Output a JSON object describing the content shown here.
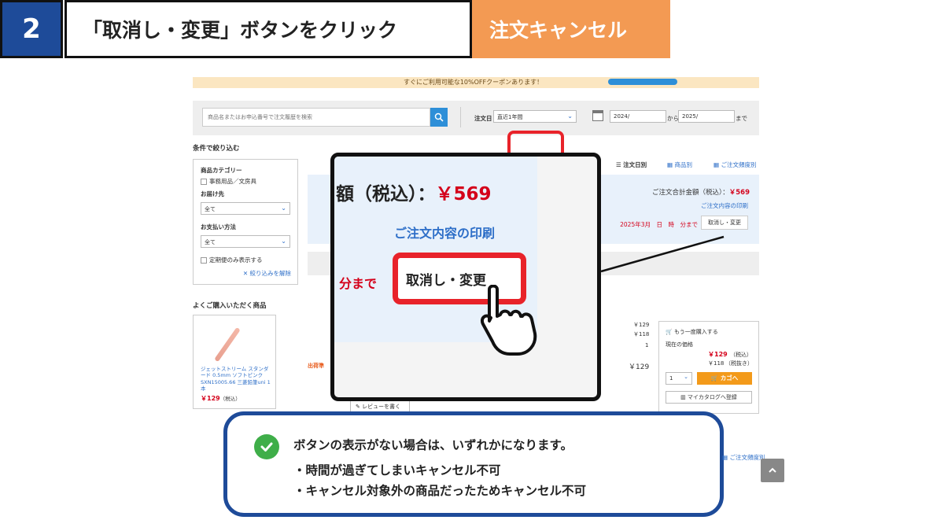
{
  "header": {
    "step_number": "2",
    "title": "「取消し・変更」ボタンをクリック",
    "tag": "注文キャンセル"
  },
  "colors": {
    "step_blue": "#1e4b99",
    "tag_orange": "#f39a53",
    "highlight_red": "#e8232a",
    "price_red": "#d4001a",
    "check_green": "#3fae49"
  },
  "promo": {
    "text": "すぐにご利用可能な10%OFFクーポンあります！"
  },
  "search": {
    "placeholder": "商品名またはお申込番号で注文履歴を検索",
    "order_date_label": "注文日",
    "period_value": "直近1年間",
    "date_from": "2024/",
    "from_word": "から",
    "date_to": "2025/",
    "until_word": "まで"
  },
  "sidebar": {
    "title": "条件で絞り込む",
    "category_heading": "商品カテゴリー",
    "category_option": "事務用品／文房具",
    "delivery_heading": "お届け先",
    "delivery_value": "全て",
    "payment_heading": "お支払い方法",
    "payment_value": "全て",
    "subscription_option": "定期便のみ表示する",
    "clear_link": "✕ 絞り込みを解除"
  },
  "favorites": {
    "title": "よくご購入いただく商品",
    "product_name": "ジェットストリーム スタンダード 0.5mm ソフトピンク SXN15005.66 三菱鉛筆uni 1本",
    "price": "￥129",
    "tax_note": "（税込）"
  },
  "view_links": {
    "by_date": "注文日別",
    "by_product": "商品別",
    "by_frequency": "ご注文頻度別"
  },
  "order": {
    "total_label": "ご注文合計金額（税込）：",
    "total_value": "￥569",
    "print_link": "ご注文内容の印刷",
    "deadline": "2025年3月　日　時　分まで",
    "cancel_button": "取消し・変更",
    "shipping_status": "出荷準"
  },
  "cart": {
    "reorder_label": "もう一度購入する",
    "current_price_label": "現在の価格",
    "price_incl": "￥129",
    "price_incl_note": "（税込）",
    "price_excl": "￥118",
    "price_excl_note": "（税抜き）",
    "qty": "1",
    "add_to_cart": "カゴへ",
    "add_to_catalog": "マイカタログへ登録",
    "line_price_1": "￥129",
    "line_price_2": "￥118",
    "line_qty": "1",
    "line_total": "￥129",
    "review_button": "レビューを書く"
  },
  "zoom": {
    "total_text": "額（税込）：",
    "total_value": "￥569",
    "print_link": "ご注文内容の印刷",
    "until": "分まで",
    "cancel_button": "取消し・変更"
  },
  "note": {
    "main": "ボタンの表示がない場合は、いずれかになります。",
    "item1": "・時間が過ぎてしまいキャンセル不可",
    "item2": "・キャンセル対象外の商品だったためキャンセル不可"
  },
  "footer": {
    "freq_link": "ご注文頻度別"
  }
}
